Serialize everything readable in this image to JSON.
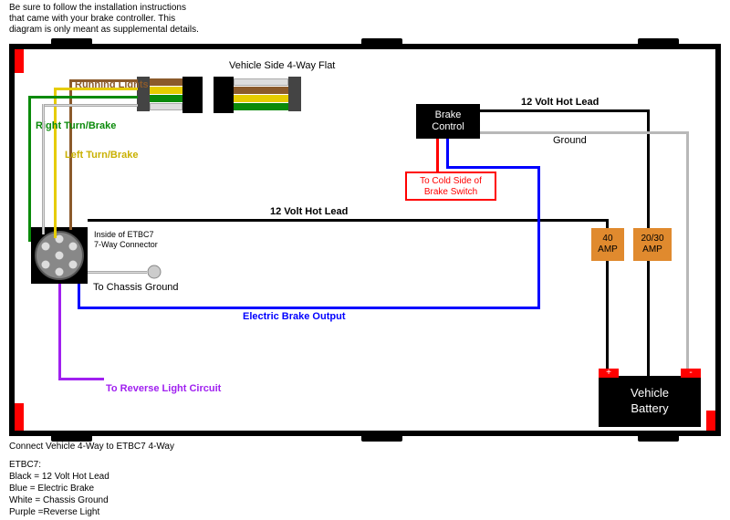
{
  "instructions": "Be sure to follow the installation instructions\nthat came with your brake controller. This\ndiagram is only meant as supplemental details.",
  "labels": {
    "running_lights": "Running Lights",
    "right_turn": "Right Turn/Brake",
    "left_turn": "Left Turn/Brake",
    "vehicle_4way": "Vehicle Side 4-Way Flat",
    "hot_lead_top": "12 Volt Hot Lead",
    "hot_lead_mid": "12 Volt Hot Lead",
    "ground": "Ground",
    "brake_control": "Brake\nControl",
    "cold_side": "To Cold Side of\nBrake Switch",
    "amp40": "40\nAMP",
    "amp2030": "20/30\nAMP",
    "battery": "Vehicle\nBattery",
    "battery_plus": "+",
    "battery_minus": "-",
    "chassis_ground": "To Chassis Ground",
    "connector_inside": "Inside of ETBC7\n7-Way Connector",
    "electric_brake": "Electric Brake Output",
    "reverse": "To Reverse Light Circuit"
  },
  "footer": {
    "connect": "Connect Vehicle 4-Way to ETBC7 4-Way",
    "legend_title": "ETBC7:",
    "l1": "Black = 12 Volt Hot Lead",
    "l2": "Blue = Electric Brake",
    "l3": "White = Chassis Ground",
    "l4": "Purple =Reverse Light"
  },
  "colors": {
    "brown": "#8b5a2b",
    "green": "#0a8a0a",
    "yellow": "#e6cc00",
    "blue": "#0000ff",
    "purple": "#a020f0",
    "red": "#f00",
    "gray": "#b8b8b8",
    "orange": "#e08a2e"
  }
}
